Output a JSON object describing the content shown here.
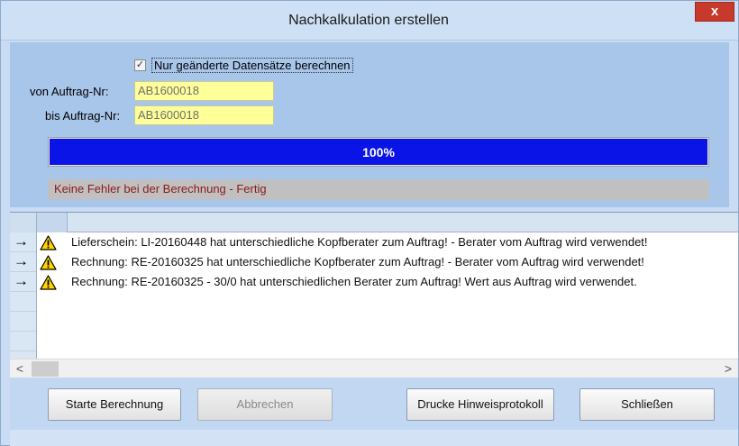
{
  "window": {
    "title": "Nachkalkulation erstellen",
    "close_label": "x"
  },
  "form": {
    "checkbox": {
      "checked": true,
      "mark": "✓",
      "label": "Nur geänderte Datensätze berechnen"
    },
    "from_label": "von Auftrag-Nr:",
    "from_value": "AB1600018",
    "to_label": "bis Auftrag-Nr:",
    "to_value": "AB1600018"
  },
  "progress": {
    "percent": 100,
    "text": "100%",
    "color": "#0b14e6"
  },
  "status": {
    "text": "Keine Fehler bei der Berechnung - Fertig",
    "color": "#8b1a1a"
  },
  "grid": {
    "rows": [
      {
        "arrow": "→",
        "icon": "warning-icon",
        "text": "Lieferschein: LI-20160448 hat unterschiedliche Kopfberater zum Auftrag! - Berater vom Auftrag wird verwendet!"
      },
      {
        "arrow": "→",
        "icon": "warning-icon",
        "text": "Rechnung: RE-20160325 hat unterschiedliche Kopfberater zum Auftrag! - Berater vom Auftrag wird verwendet!"
      },
      {
        "arrow": "→",
        "icon": "warning-icon",
        "text": "Rechnung: RE-20160325 - 30/0 hat unterschiedlichen Berater zum Auftrag! Wert aus Auftrag wird verwendet."
      }
    ],
    "scroll_left": "<",
    "scroll_right": ">"
  },
  "buttons": {
    "start": "Starte Berechnung",
    "cancel": "Abbrechen",
    "print": "Drucke Hinweisprotokoll",
    "close": "Schließen"
  }
}
